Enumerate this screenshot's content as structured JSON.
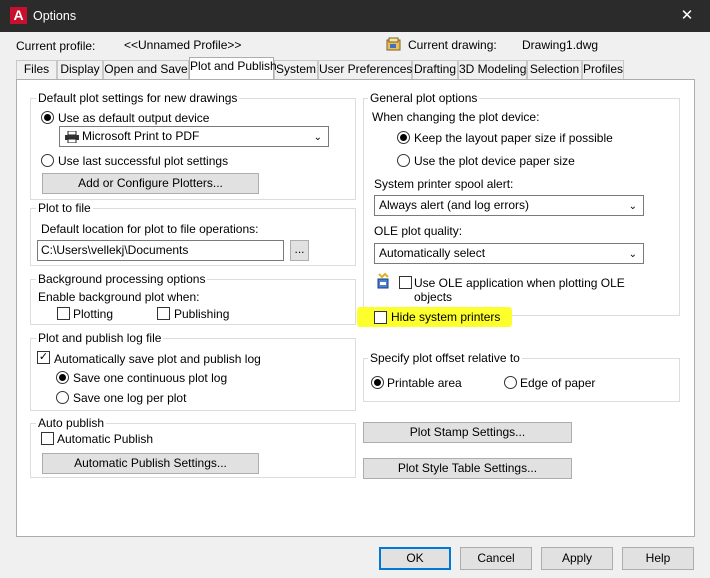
{
  "window": {
    "app_icon_letter": "A",
    "title": "Options",
    "close_glyph": "✕"
  },
  "profile": {
    "current_profile_label": "Current profile:",
    "current_profile_value": "<<Unnamed Profile>>",
    "current_drawing_label": "Current drawing:",
    "current_drawing_value": "Drawing1.dwg"
  },
  "tabs": [
    "Files",
    "Display",
    "Open and Save",
    "Plot and Publish",
    "System",
    "User Preferences",
    "Drafting",
    "3D Modeling",
    "Selection",
    "Profiles"
  ],
  "active_tab": "Plot and Publish",
  "default_plot": {
    "title": "Default plot settings for new drawings",
    "use_default_label": "Use as default output device",
    "device_value": "Microsoft Print to PDF",
    "use_last_label": "Use last successful plot settings",
    "add_plotters_label": "Add or Configure Plotters..."
  },
  "plot_to_file": {
    "title": "Plot to file",
    "location_label": "Default location for plot to file operations:",
    "location_value": "C:\\Users\\vellekj\\Documents",
    "browse_label": "..."
  },
  "background": {
    "title": "Background processing options",
    "enable_label": "Enable background plot when:",
    "plotting_label": "Plotting",
    "publishing_label": "Publishing"
  },
  "log": {
    "title": "Plot and publish log file",
    "auto_save_label": "Automatically save plot and publish log",
    "continuous_label": "Save one continuous plot log",
    "per_plot_label": "Save one log per plot"
  },
  "auto_publish": {
    "title": "Auto publish",
    "automatic_label": "Automatic Publish",
    "settings_label": "Automatic Publish Settings..."
  },
  "general": {
    "title": "General plot options",
    "changing_label": "When changing the plot device:",
    "keep_layout_label": "Keep the layout paper size if possible",
    "use_device_label": "Use the plot device paper size",
    "spool_label": "System printer spool alert:",
    "spool_value": "Always alert (and log errors)",
    "ole_quality_label": "OLE plot quality:",
    "ole_quality_value": "Automatically select",
    "use_ole_label_1": "Use OLE application when plotting OLE",
    "use_ole_label_2": "objects",
    "hide_printers_label": "Hide system printers"
  },
  "offset": {
    "title": "Specify plot offset relative to",
    "printable_label": "Printable area",
    "edge_label": "Edge of paper"
  },
  "buttons": {
    "plot_stamp": "Plot Stamp Settings...",
    "plot_style": "Plot Style Table Settings...",
    "ok": "OK",
    "cancel": "Cancel",
    "apply": "Apply",
    "help": "Help"
  },
  "colors": {
    "highlight": "#fcff2b",
    "title_bar": "#2b2b2b",
    "default_button_border": "#0078d7"
  }
}
